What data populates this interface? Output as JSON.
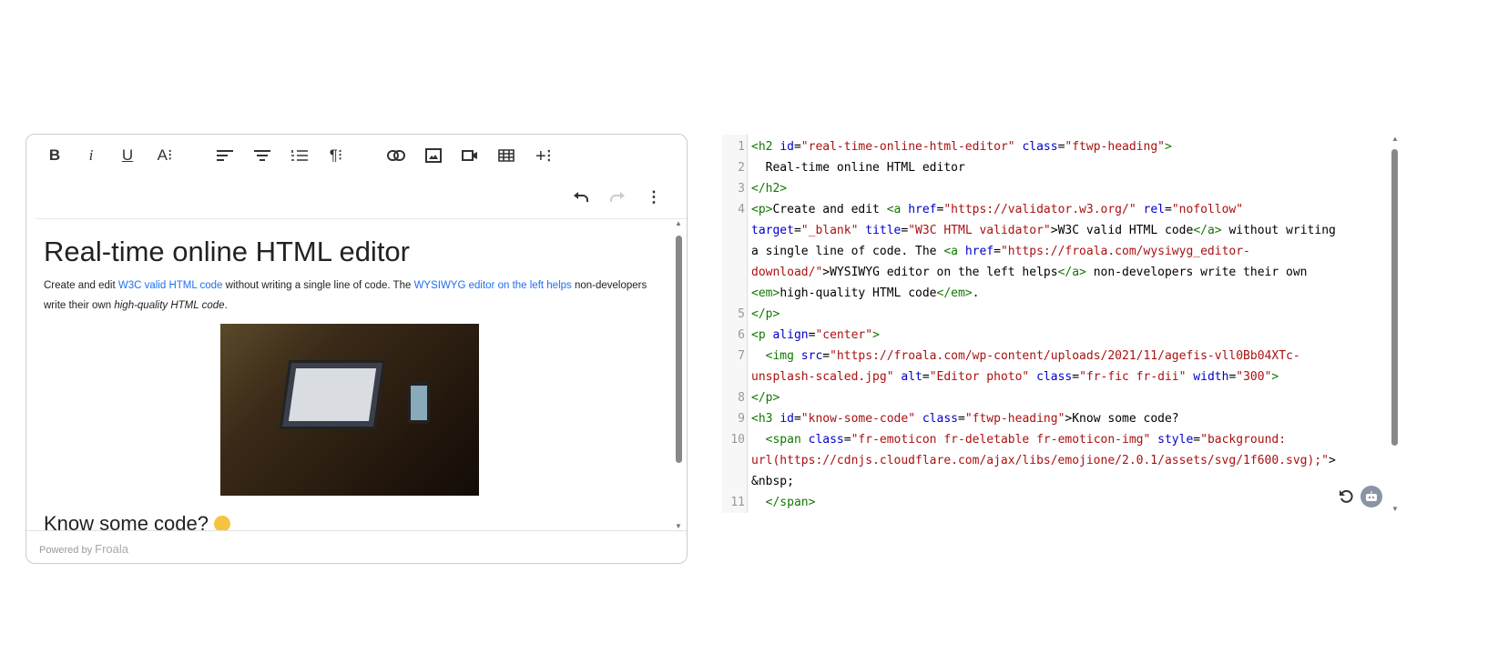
{
  "toolbar": {
    "buttons": [
      "bold",
      "italic",
      "underline",
      "text-format",
      "align-left",
      "align-center",
      "ordered-list",
      "paragraph-format",
      "link",
      "image",
      "video",
      "table",
      "more"
    ],
    "undo": "undo",
    "redo": "redo",
    "more_menu": "more-menu"
  },
  "content": {
    "heading": "Real-time online HTML editor",
    "p_start": "Create and edit ",
    "link1": "W3C valid HTML code",
    "p_mid": " without writing a single line of code. The ",
    "link2": "WYSIWYG editor on the left helps",
    "p_end": " non-developers write their own ",
    "em": "high-quality HTML code",
    "p_period": ".",
    "heading2": "Know some code?"
  },
  "footer": {
    "powered": "Powered by",
    "brand": "Froala"
  },
  "code_lines": [
    {
      "n": "1",
      "tokens": [
        [
          "t",
          "<h2 "
        ],
        [
          "a",
          "id"
        ],
        [
          "x",
          "="
        ],
        [
          "s",
          "\"real-time-online-html-editor\""
        ],
        [
          "x",
          " "
        ],
        [
          "a",
          "class"
        ],
        [
          "x",
          "="
        ],
        [
          "s",
          "\"ftwp-heading\""
        ],
        [
          "t",
          ">"
        ]
      ]
    },
    {
      "n": "2",
      "tokens": [
        [
          "x",
          "  Real-time online HTML editor"
        ]
      ]
    },
    {
      "n": "3",
      "tokens": [
        [
          "t",
          "</h2>"
        ]
      ]
    },
    {
      "n": "4",
      "tokens": [
        [
          "t",
          "<p>"
        ],
        [
          "x",
          "Create and edit "
        ],
        [
          "t",
          "<a "
        ],
        [
          "a",
          "href"
        ],
        [
          "x",
          "="
        ],
        [
          "s",
          "\"https://validator.w3.org/\""
        ],
        [
          "x",
          " "
        ],
        [
          "a",
          "rel"
        ],
        [
          "x",
          "="
        ],
        [
          "s",
          "\"nofollow\""
        ]
      ]
    },
    {
      "n": "",
      "tokens": [
        [
          "a",
          "target"
        ],
        [
          "x",
          "="
        ],
        [
          "s",
          "\"_blank\""
        ],
        [
          "x",
          " "
        ],
        [
          "a",
          "title"
        ],
        [
          "x",
          "="
        ],
        [
          "s",
          "\"W3C HTML validator\""
        ],
        [
          "x",
          ">W3C valid HTML code"
        ],
        [
          "t",
          "</a>"
        ],
        [
          "x",
          " without writing"
        ]
      ]
    },
    {
      "n": "",
      "tokens": [
        [
          "x",
          "a single line of code. The "
        ],
        [
          "t",
          "<a "
        ],
        [
          "a",
          "href"
        ],
        [
          "x",
          "="
        ],
        [
          "s",
          "\"https://froala.com/wysiwyg_editor-"
        ]
      ]
    },
    {
      "n": "",
      "tokens": [
        [
          "s",
          "download/\""
        ],
        [
          "x",
          ">WYSIWYG editor on the left helps"
        ],
        [
          "t",
          "</a>"
        ],
        [
          "x",
          " non-developers write their own"
        ]
      ]
    },
    {
      "n": "",
      "tokens": [
        [
          "t",
          "<em>"
        ],
        [
          "x",
          "high-quality HTML code"
        ],
        [
          "t",
          "</em>"
        ],
        [
          "x",
          "."
        ]
      ]
    },
    {
      "n": "5",
      "tokens": [
        [
          "t",
          "</p>"
        ]
      ]
    },
    {
      "n": "6",
      "tokens": [
        [
          "t",
          "<p "
        ],
        [
          "a",
          "align"
        ],
        [
          "x",
          "="
        ],
        [
          "s",
          "\"center\""
        ],
        [
          "t",
          ">"
        ]
      ]
    },
    {
      "n": "7",
      "tokens": [
        [
          "x",
          "  "
        ],
        [
          "t",
          "<img "
        ],
        [
          "a",
          "src"
        ],
        [
          "x",
          "="
        ],
        [
          "s",
          "\"https://froala.com/wp-content/uploads/2021/11/agefis-vll0Bb04XTc-"
        ]
      ]
    },
    {
      "n": "",
      "tokens": [
        [
          "s",
          "unsplash-scaled.jpg\""
        ],
        [
          "x",
          " "
        ],
        [
          "a",
          "alt"
        ],
        [
          "x",
          "="
        ],
        [
          "s",
          "\"Editor photo\""
        ],
        [
          "x",
          " "
        ],
        [
          "a",
          "class"
        ],
        [
          "x",
          "="
        ],
        [
          "s",
          "\"fr-fic fr-dii\""
        ],
        [
          "x",
          " "
        ],
        [
          "a",
          "width"
        ],
        [
          "x",
          "="
        ],
        [
          "s",
          "\"300\""
        ],
        [
          "t",
          ">"
        ]
      ]
    },
    {
      "n": "8",
      "tokens": [
        [
          "t",
          "</p>"
        ]
      ]
    },
    {
      "n": "9",
      "tokens": [
        [
          "t",
          "<h3 "
        ],
        [
          "a",
          "id"
        ],
        [
          "x",
          "="
        ],
        [
          "s",
          "\"know-some-code\""
        ],
        [
          "x",
          " "
        ],
        [
          "a",
          "class"
        ],
        [
          "x",
          "="
        ],
        [
          "s",
          "\"ftwp-heading\""
        ],
        [
          "x",
          ">Know some code?"
        ]
      ]
    },
    {
      "n": "10",
      "tokens": [
        [
          "x",
          "  "
        ],
        [
          "t",
          "<span "
        ],
        [
          "a",
          "class"
        ],
        [
          "x",
          "="
        ],
        [
          "s",
          "\"fr-emoticon fr-deletable fr-emoticon-img\""
        ],
        [
          "x",
          " "
        ],
        [
          "a",
          "style"
        ],
        [
          "x",
          "="
        ],
        [
          "s",
          "\"background:"
        ]
      ]
    },
    {
      "n": "",
      "tokens": [
        [
          "s",
          "url(https://cdnjs.cloudflare.com/ajax/libs/emojione/2.0.1/assets/svg/1f600.svg);\""
        ],
        [
          "x",
          ">"
        ]
      ]
    },
    {
      "n": "",
      "tokens": [
        [
          "x",
          "&nbsp;"
        ]
      ]
    },
    {
      "n": "11",
      "tokens": [
        [
          "x",
          "  "
        ],
        [
          "t",
          "</span>"
        ]
      ]
    }
  ]
}
